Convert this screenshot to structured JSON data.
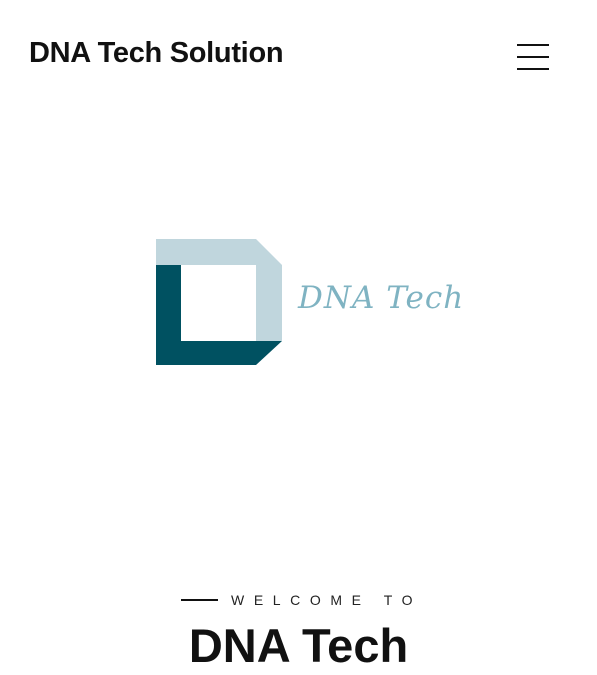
{
  "header": {
    "site_title": "DNA Tech Solution",
    "menu_icon": "hamburger-menu-icon"
  },
  "hero": {
    "logo": {
      "wordmark": "DNA Tech",
      "colors": {
        "dark": "#005161",
        "light": "#c0d6dd",
        "wordmark": "#7fb3c2"
      }
    },
    "welcome_label": "WELCOME TO",
    "heading": "DNA Tech"
  }
}
